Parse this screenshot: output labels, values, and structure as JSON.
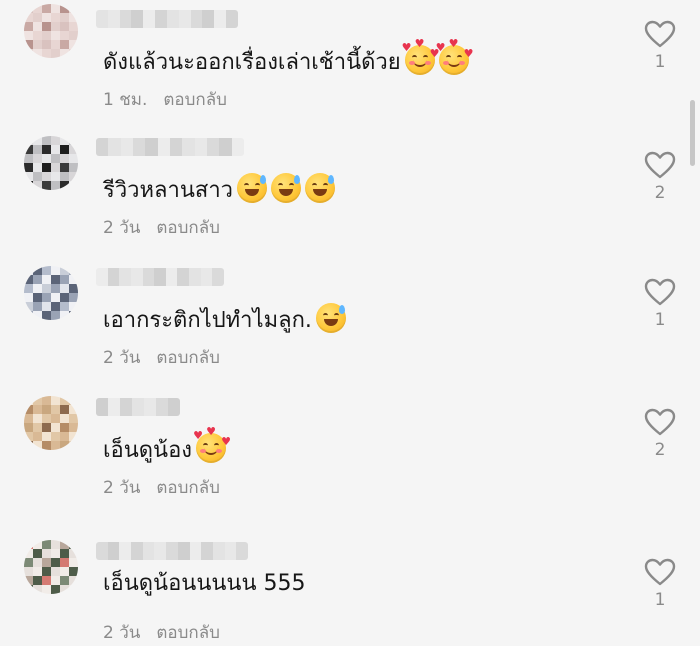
{
  "comments": [
    {
      "text": "ดังแล้วนะออกเรื่องเล่าเช้านี้ด้วย",
      "emojis": [
        "smiling-face-with-hearts-icon",
        "smiling-face-with-hearts-icon"
      ],
      "time": "1 ชม.",
      "reply": "ตอบกลับ",
      "likes": "1"
    },
    {
      "text": "รีวิวหลานสาว",
      "emojis": [
        "grinning-sweat-icon",
        "grinning-sweat-icon",
        "grinning-sweat-icon"
      ],
      "time": "2 วัน",
      "reply": "ตอบกลับ",
      "likes": "2"
    },
    {
      "text": "เอากระติกไปทำไมลูก.",
      "emojis": [
        "grinning-sweat-icon"
      ],
      "time": "2 วัน",
      "reply": "ตอบกลับ",
      "likes": "1"
    },
    {
      "text": "เอ็นดูน้อง",
      "emojis": [
        "smiling-face-with-hearts-icon"
      ],
      "time": "2 วัน",
      "reply": "ตอบกลับ",
      "likes": "2"
    },
    {
      "text": "เอ็นดูน้อนนนนน 555",
      "emojis": [],
      "time": "2 วัน",
      "reply": "ตอบกลับ",
      "likes": "1"
    }
  ],
  "colors": {
    "background": "#f5f5f5",
    "text": "#161616",
    "meta": "#8a8a8a",
    "heart_outline": "#8a8a8a"
  }
}
